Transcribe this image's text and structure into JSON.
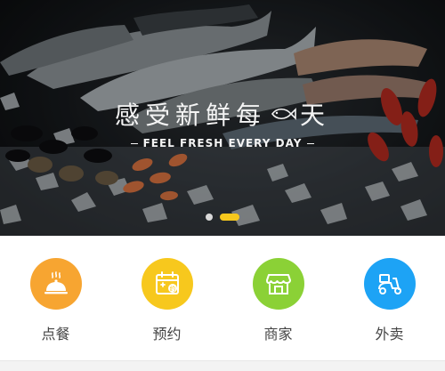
{
  "banner": {
    "slogan_cn_left": "感受新鲜每",
    "slogan_cn_right": "天",
    "slogan_en": "FEEL FRESH EVERY DAY",
    "carousel_active_index": 1,
    "carousel_count": 2
  },
  "nav": [
    {
      "label": "点餐",
      "icon": "cloche-icon",
      "color": "#f7a531"
    },
    {
      "label": "预约",
      "icon": "calendar-icon",
      "color": "#f7c81d"
    },
    {
      "label": "商家",
      "icon": "store-icon",
      "color": "#8bd136"
    },
    {
      "label": "外卖",
      "icon": "scooter-icon",
      "color": "#1da3f5"
    }
  ],
  "colors": {
    "accent_yellow": "#f7c81d",
    "label_text": "#444444"
  }
}
